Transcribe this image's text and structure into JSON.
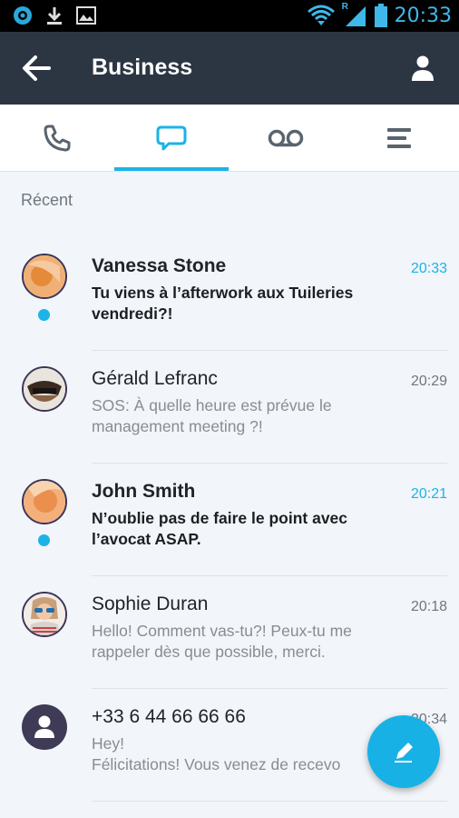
{
  "status_bar": {
    "time": "20:33",
    "roaming_indicator": "R",
    "left_icons": [
      "app-notification-icon",
      "download-icon",
      "image-icon"
    ],
    "right_icons": [
      "wifi-icon",
      "signal-icon",
      "battery-icon"
    ]
  },
  "app_bar": {
    "title": "Business",
    "back_icon": "arrow-back-icon",
    "profile_icon": "person-icon"
  },
  "tabs": [
    {
      "name": "calls",
      "icon": "phone-icon",
      "selected": false
    },
    {
      "name": "messages",
      "icon": "chat-bubble-icon",
      "selected": true
    },
    {
      "name": "voicemail",
      "icon": "voicemail-icon",
      "selected": false
    },
    {
      "name": "menu",
      "icon": "menu-lines-icon",
      "selected": false
    }
  ],
  "section_label": "Récent",
  "conversations": [
    {
      "name": "Vanessa Stone",
      "time": "20:33",
      "preview": "Tu viens à l’afterwork aux Tuileries vendredi?!",
      "unread": true
    },
    {
      "name": "Gérald Lefranc",
      "time": "20:29",
      "preview": "SOS: À quelle heure est prévue le management meeting ?!",
      "unread": false
    },
    {
      "name": "John Smith",
      "time": "20:21",
      "preview": "N’oublie pas de faire le point avec l’avocat ASAP.",
      "unread": true
    },
    {
      "name": "Sophie Duran",
      "time": "20:18",
      "preview": "Hello! Comment vas-tu?! Peux-tu me rappeler dès que possible, merci.",
      "unread": false
    },
    {
      "name": "+33 6 44 66 66 66",
      "time": "20:34",
      "preview": "Hey!\nFélicitations! Vous venez de recevo",
      "unread": false
    }
  ],
  "fab": {
    "icon": "pencil-icon"
  },
  "colors": {
    "accent": "#1bb3e8",
    "app_bar": "#2c3643",
    "avatar_border": "#3c3458"
  }
}
